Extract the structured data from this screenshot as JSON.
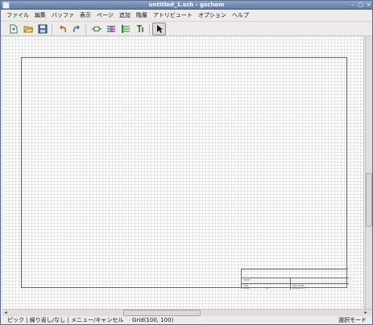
{
  "window": {
    "title": "untitled_1.sch - gschem"
  },
  "window_controls": {
    "minimize": "–",
    "maximize": "□",
    "close": "×"
  },
  "menubar": {
    "items": [
      "ファイル",
      "編集",
      "バッファ",
      "表示",
      "ページ",
      "追加",
      "階層",
      "アトリビュート",
      "オプション",
      "ヘルプ"
    ]
  },
  "toolbar": {
    "buttons": [
      {
        "name": "new-page",
        "icon": "new-document-icon"
      },
      {
        "name": "open",
        "icon": "open-folder-icon"
      },
      {
        "name": "save",
        "icon": "save-disk-icon"
      },
      {
        "name": "undo",
        "icon": "undo-arrow-icon"
      },
      {
        "name": "redo",
        "icon": "redo-arrow-icon"
      },
      {
        "name": "add-component",
        "icon": "component-icon"
      },
      {
        "name": "add-net",
        "icon": "net-icon"
      },
      {
        "name": "add-bus",
        "icon": "bus-icon"
      },
      {
        "name": "add-text",
        "icon": "text-icon"
      },
      {
        "name": "select",
        "icon": "pointer-icon",
        "active": true
      }
    ]
  },
  "titleblock": {
    "title_label": "TITLE",
    "file_label": "FILE:",
    "page_label": "PAGE",
    "of_label": "OF",
    "revision_label": "REVISION:",
    "drawn_label": "DRAWN BY:"
  },
  "scroll_arrows": {
    "left": "◂",
    "right": "▸"
  },
  "statusbar": {
    "left_text": "ピック | 繰り返し/なし | メニュー/キャンセル",
    "grid_text": "Grid(100, 100)",
    "mode_text": "選択モード"
  },
  "colors": {
    "titlebar": "#6f8ab3",
    "chrome": "#edeceb",
    "grid_line": "#e4e4e4",
    "frame_line": "#6a6a6a"
  }
}
